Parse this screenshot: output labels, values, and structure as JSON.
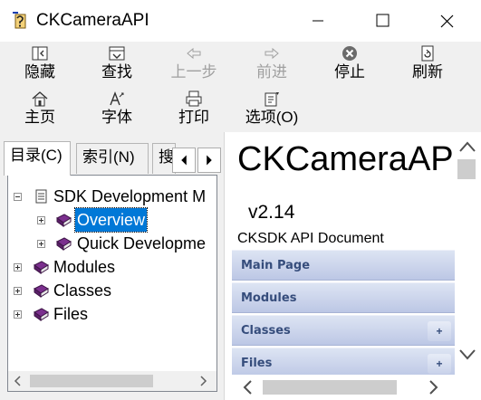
{
  "window": {
    "title": "CKCameraAPI"
  },
  "toolbar": {
    "row1": [
      {
        "label": "隐藏",
        "icon": "hide-icon",
        "enabled": true
      },
      {
        "label": "查找",
        "icon": "locate-icon",
        "enabled": true
      },
      {
        "label": "上一步",
        "icon": "back-arrow-icon",
        "enabled": false
      },
      {
        "label": "前进",
        "icon": "forward-arrow-icon",
        "enabled": false
      },
      {
        "label": "停止",
        "icon": "stop-icon",
        "enabled": true
      },
      {
        "label": "刷新",
        "icon": "refresh-icon",
        "enabled": true
      }
    ],
    "row2": [
      {
        "label": "主页",
        "icon": "home-icon",
        "enabled": true
      },
      {
        "label": "字体",
        "icon": "font-icon",
        "enabled": true
      },
      {
        "label": "打印",
        "icon": "print-icon",
        "enabled": true
      },
      {
        "label": "选项(O)",
        "icon": "options-icon",
        "enabled": true
      }
    ]
  },
  "tabs": [
    {
      "label": "目录(C)",
      "active": true
    },
    {
      "label": "索引(N)",
      "active": false
    },
    {
      "label": "搜",
      "active": false
    }
  ],
  "tree": [
    {
      "label": "SDK Development M",
      "level": 0,
      "expander": "minus",
      "icon": "page-icon"
    },
    {
      "label": "Overview",
      "level": 1,
      "expander": "plus",
      "icon": "book-icon",
      "selected": true
    },
    {
      "label": "Quick Developme",
      "level": 1,
      "expander": "plus",
      "icon": "book-icon"
    },
    {
      "label": "Modules",
      "level": 0,
      "expander": "plus",
      "icon": "book-icon"
    },
    {
      "label": "Classes",
      "level": 0,
      "expander": "plus",
      "icon": "book-icon"
    },
    {
      "label": "Files",
      "level": 0,
      "expander": "plus",
      "icon": "book-icon"
    }
  ],
  "document": {
    "title": "CKCameraAPI",
    "version": "v2.14",
    "subtitle": "CKSDK API Document",
    "nav": [
      {
        "label": "Main Page",
        "has_plus": false
      },
      {
        "label": "Modules",
        "has_plus": false
      },
      {
        "label": "Classes",
        "has_plus": true,
        "plus_label": "+"
      },
      {
        "label": "Files",
        "has_plus": true,
        "plus_label": "+"
      }
    ]
  },
  "colors": {
    "selection": "#0078d7",
    "nav_text": "#364d7c",
    "book": "#7b2f8e"
  }
}
